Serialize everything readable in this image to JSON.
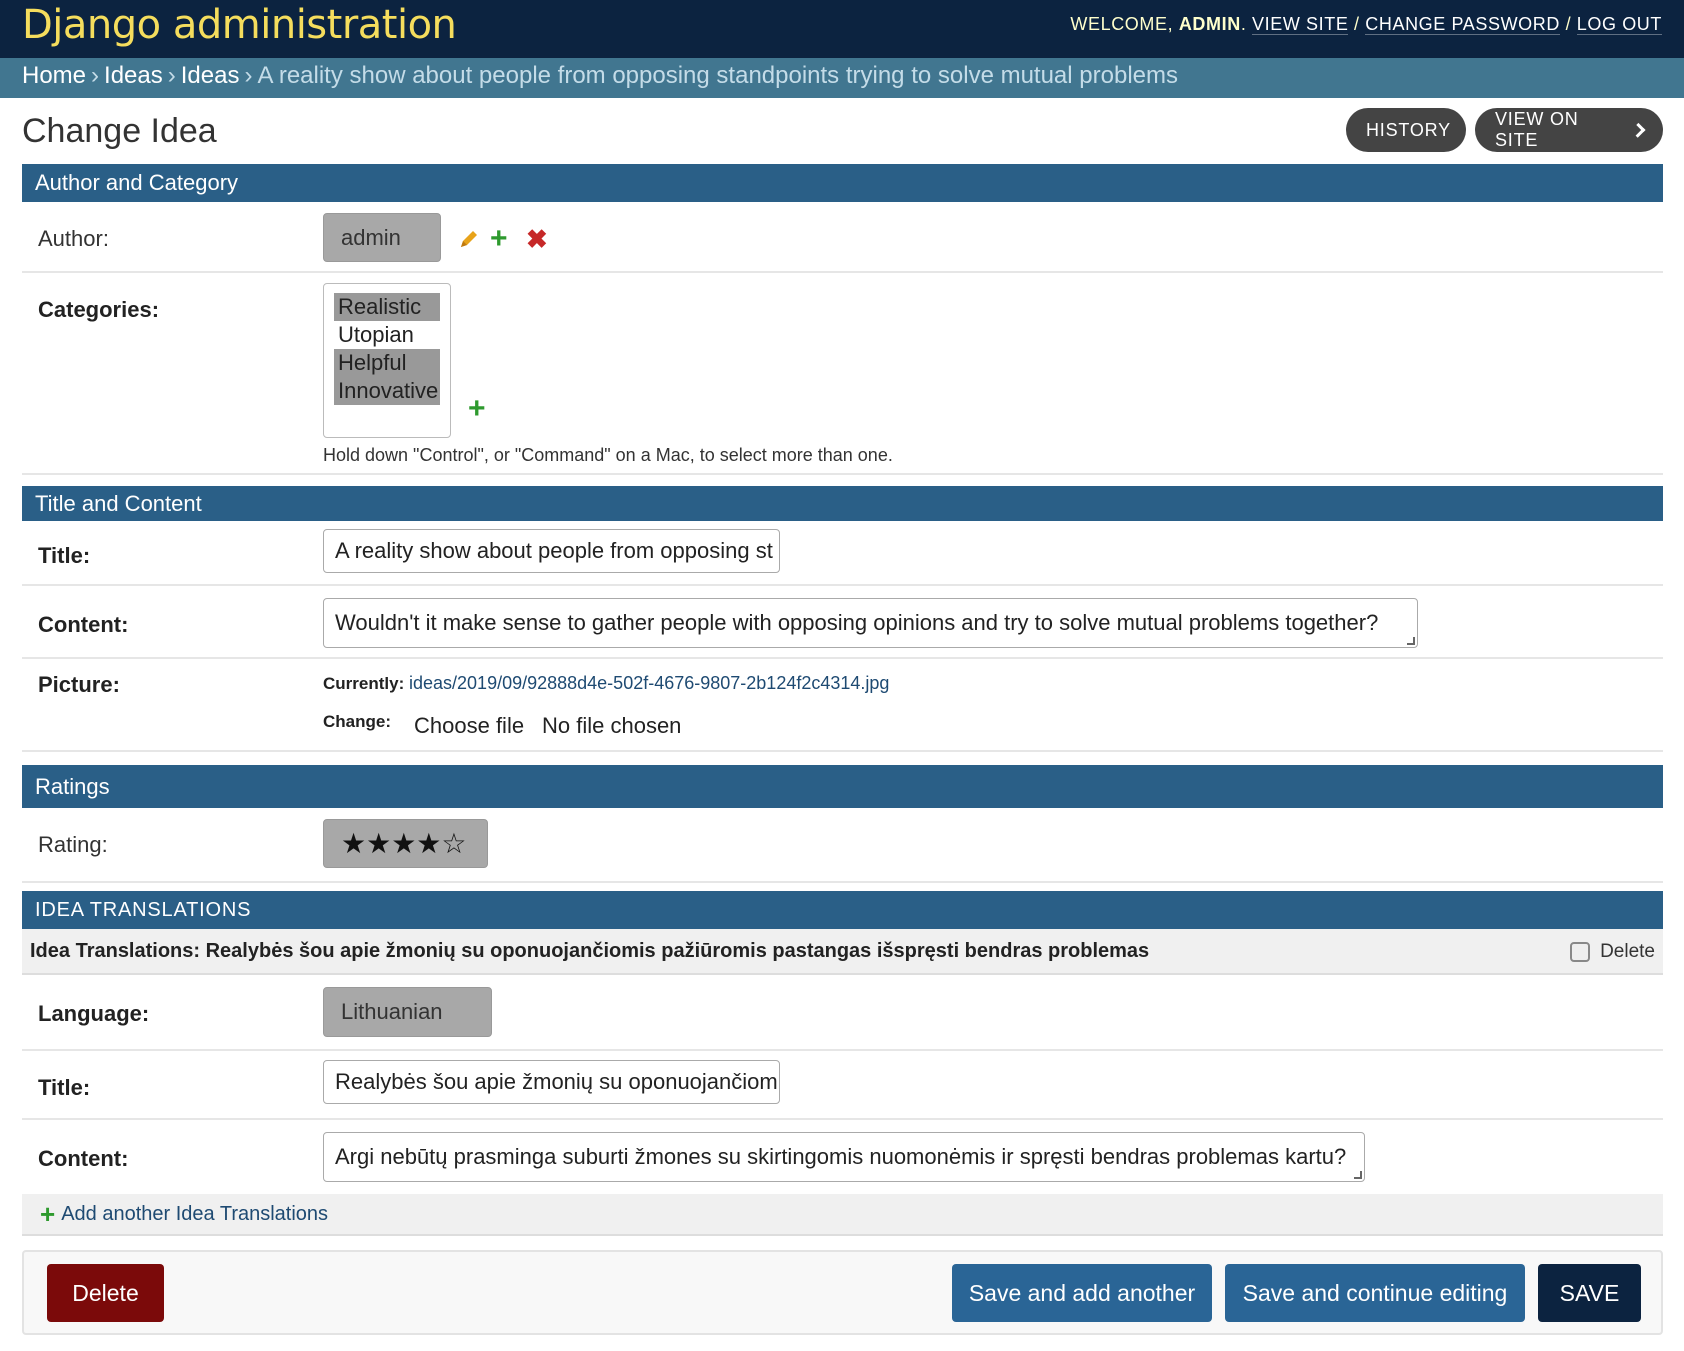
{
  "header": {
    "site_name": "Django administration",
    "welcome": "WELCOME,",
    "username": "ADMIN",
    "view_site": "VIEW SITE",
    "change_password": "CHANGE PASSWORD",
    "log_out": "LOG OUT",
    "separator": "/"
  },
  "breadcrumbs": {
    "home": "Home",
    "app": "Ideas",
    "model": "Ideas",
    "current": "A reality show about people from opposing standpoints trying to solve mutual problems",
    "sep": "›"
  },
  "page": {
    "title": "Change Idea",
    "history_label": "HISTORY",
    "view_on_site_label": "VIEW ON SITE"
  },
  "sections": {
    "author_category": "Author and Category",
    "title_content": "Title and Content",
    "ratings": "Ratings",
    "translations": "IDEA TRANSLATIONS"
  },
  "fields": {
    "author": {
      "label": "Author:",
      "value": "admin"
    },
    "categories": {
      "label": "Categories:",
      "options": [
        {
          "label": "Realistic",
          "selected": true
        },
        {
          "label": "Utopian",
          "selected": false
        },
        {
          "label": "Helpful",
          "selected": true
        },
        {
          "label": "Innovative",
          "selected": true
        }
      ],
      "help": "Hold down \"Control\", or \"Command\" on a Mac, to select more than one."
    },
    "title": {
      "label": "Title:",
      "value": "A reality show about people from opposing st"
    },
    "content": {
      "label": "Content:",
      "value": "Wouldn't it make sense to gather people with opposing opinions and try to solve mutual problems together?"
    },
    "picture": {
      "label": "Picture:",
      "currently_label": "Currently:",
      "currently_value": "ideas/2019/09/92888d4e-502f-4676-9807-2b124f2c4314.jpg",
      "change_label": "Change:",
      "choose_file": "Choose file",
      "no_file": "No file chosen"
    },
    "rating": {
      "label": "Rating:",
      "value": "★★★★☆",
      "stars": 4,
      "max": 5
    }
  },
  "translation": {
    "header": "Idea Translations: Realybės šou apie žmonių su oponuojančiomis pažiūromis pastangas išspręsti bendras problemas",
    "delete_label": "Delete",
    "language": {
      "label": "Language:",
      "value": "Lithuanian"
    },
    "title": {
      "label": "Title:",
      "value": "Realybės šou apie žmonių su oponuojančiom"
    },
    "content": {
      "label": "Content:",
      "value": "Argi nebūtų prasminga suburti žmones su skirtingomis nuomonėmis ir spręsti bendras problemas kartu?"
    },
    "add_another": "Add another Idea Translations"
  },
  "icons": {
    "edit": "pencil-icon",
    "add": "plus-icon",
    "delete": "x-icon"
  },
  "colors": {
    "header_bg": "#0c2340",
    "site_name": "#f5dd5d",
    "breadcrumbs_bg": "#417690",
    "section_bg": "#2a5f87",
    "delete_btn": "#7b0a0a",
    "save_btn": "#0c2340",
    "secondary_btn": "#2a6596"
  },
  "actions": {
    "delete": "Delete",
    "save_add_another": "Save and add another",
    "save_continue": "Save and continue editing",
    "save": "SAVE"
  }
}
